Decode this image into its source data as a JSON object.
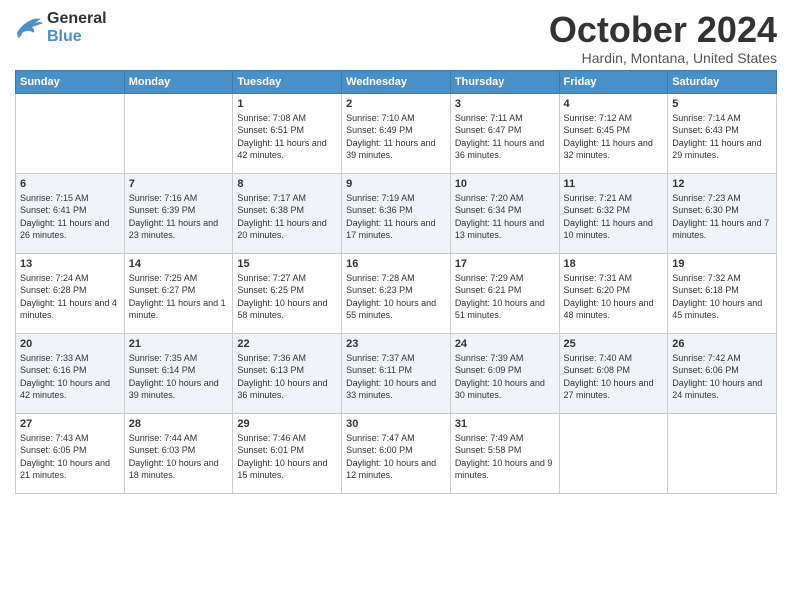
{
  "header": {
    "logo_general": "General",
    "logo_blue": "Blue",
    "month_title": "October 2024",
    "location": "Hardin, Montana, United States"
  },
  "weekdays": [
    "Sunday",
    "Monday",
    "Tuesday",
    "Wednesday",
    "Thursday",
    "Friday",
    "Saturday"
  ],
  "weeks": [
    [
      {
        "day": "",
        "info": ""
      },
      {
        "day": "",
        "info": ""
      },
      {
        "day": "1",
        "info": "Sunrise: 7:08 AM\nSunset: 6:51 PM\nDaylight: 11 hours and 42 minutes."
      },
      {
        "day": "2",
        "info": "Sunrise: 7:10 AM\nSunset: 6:49 PM\nDaylight: 11 hours and 39 minutes."
      },
      {
        "day": "3",
        "info": "Sunrise: 7:11 AM\nSunset: 6:47 PM\nDaylight: 11 hours and 36 minutes."
      },
      {
        "day": "4",
        "info": "Sunrise: 7:12 AM\nSunset: 6:45 PM\nDaylight: 11 hours and 32 minutes."
      },
      {
        "day": "5",
        "info": "Sunrise: 7:14 AM\nSunset: 6:43 PM\nDaylight: 11 hours and 29 minutes."
      }
    ],
    [
      {
        "day": "6",
        "info": "Sunrise: 7:15 AM\nSunset: 6:41 PM\nDaylight: 11 hours and 26 minutes."
      },
      {
        "day": "7",
        "info": "Sunrise: 7:16 AM\nSunset: 6:39 PM\nDaylight: 11 hours and 23 minutes."
      },
      {
        "day": "8",
        "info": "Sunrise: 7:17 AM\nSunset: 6:38 PM\nDaylight: 11 hours and 20 minutes."
      },
      {
        "day": "9",
        "info": "Sunrise: 7:19 AM\nSunset: 6:36 PM\nDaylight: 11 hours and 17 minutes."
      },
      {
        "day": "10",
        "info": "Sunrise: 7:20 AM\nSunset: 6:34 PM\nDaylight: 11 hours and 13 minutes."
      },
      {
        "day": "11",
        "info": "Sunrise: 7:21 AM\nSunset: 6:32 PM\nDaylight: 11 hours and 10 minutes."
      },
      {
        "day": "12",
        "info": "Sunrise: 7:23 AM\nSunset: 6:30 PM\nDaylight: 11 hours and 7 minutes."
      }
    ],
    [
      {
        "day": "13",
        "info": "Sunrise: 7:24 AM\nSunset: 6:28 PM\nDaylight: 11 hours and 4 minutes."
      },
      {
        "day": "14",
        "info": "Sunrise: 7:25 AM\nSunset: 6:27 PM\nDaylight: 11 hours and 1 minute."
      },
      {
        "day": "15",
        "info": "Sunrise: 7:27 AM\nSunset: 6:25 PM\nDaylight: 10 hours and 58 minutes."
      },
      {
        "day": "16",
        "info": "Sunrise: 7:28 AM\nSunset: 6:23 PM\nDaylight: 10 hours and 55 minutes."
      },
      {
        "day": "17",
        "info": "Sunrise: 7:29 AM\nSunset: 6:21 PM\nDaylight: 10 hours and 51 minutes."
      },
      {
        "day": "18",
        "info": "Sunrise: 7:31 AM\nSunset: 6:20 PM\nDaylight: 10 hours and 48 minutes."
      },
      {
        "day": "19",
        "info": "Sunrise: 7:32 AM\nSunset: 6:18 PM\nDaylight: 10 hours and 45 minutes."
      }
    ],
    [
      {
        "day": "20",
        "info": "Sunrise: 7:33 AM\nSunset: 6:16 PM\nDaylight: 10 hours and 42 minutes."
      },
      {
        "day": "21",
        "info": "Sunrise: 7:35 AM\nSunset: 6:14 PM\nDaylight: 10 hours and 39 minutes."
      },
      {
        "day": "22",
        "info": "Sunrise: 7:36 AM\nSunset: 6:13 PM\nDaylight: 10 hours and 36 minutes."
      },
      {
        "day": "23",
        "info": "Sunrise: 7:37 AM\nSunset: 6:11 PM\nDaylight: 10 hours and 33 minutes."
      },
      {
        "day": "24",
        "info": "Sunrise: 7:39 AM\nSunset: 6:09 PM\nDaylight: 10 hours and 30 minutes."
      },
      {
        "day": "25",
        "info": "Sunrise: 7:40 AM\nSunset: 6:08 PM\nDaylight: 10 hours and 27 minutes."
      },
      {
        "day": "26",
        "info": "Sunrise: 7:42 AM\nSunset: 6:06 PM\nDaylight: 10 hours and 24 minutes."
      }
    ],
    [
      {
        "day": "27",
        "info": "Sunrise: 7:43 AM\nSunset: 6:05 PM\nDaylight: 10 hours and 21 minutes."
      },
      {
        "day": "28",
        "info": "Sunrise: 7:44 AM\nSunset: 6:03 PM\nDaylight: 10 hours and 18 minutes."
      },
      {
        "day": "29",
        "info": "Sunrise: 7:46 AM\nSunset: 6:01 PM\nDaylight: 10 hours and 15 minutes."
      },
      {
        "day": "30",
        "info": "Sunrise: 7:47 AM\nSunset: 6:00 PM\nDaylight: 10 hours and 12 minutes."
      },
      {
        "day": "31",
        "info": "Sunrise: 7:49 AM\nSunset: 5:58 PM\nDaylight: 10 hours and 9 minutes."
      },
      {
        "day": "",
        "info": ""
      },
      {
        "day": "",
        "info": ""
      }
    ]
  ]
}
